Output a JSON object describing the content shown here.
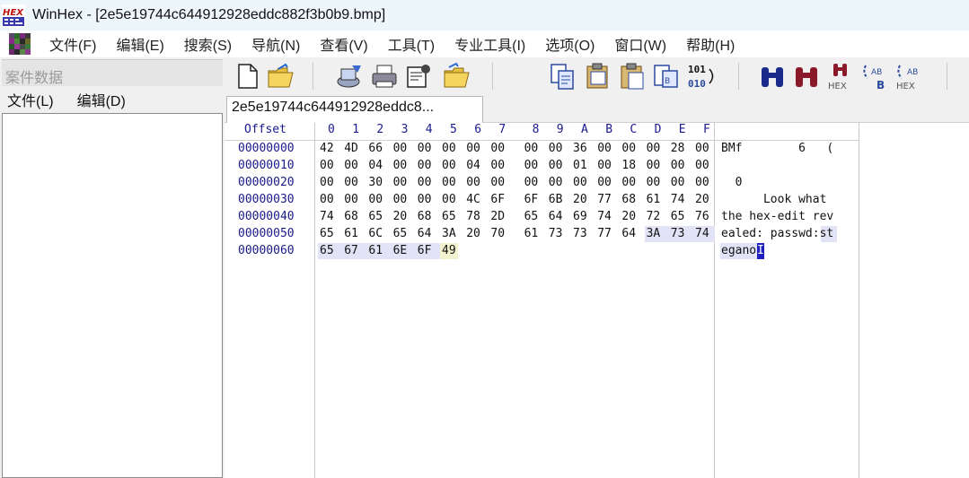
{
  "window": {
    "title": "WinHex - [2e5e19744c644912928eddc882f3b0b9.bmp]",
    "app_icon_text": "HEX"
  },
  "menu": [
    "文件(F)",
    "编辑(E)",
    "搜索(S)",
    "导航(N)",
    "查看(V)",
    "工具(T)",
    "专业工具(I)",
    "选项(O)",
    "窗口(W)",
    "帮助(H)"
  ],
  "left_pane": {
    "header": "案件数据",
    "menu": [
      "文件(L)",
      "编辑(D)"
    ]
  },
  "toolbar_icons": [
    "new-file-icon",
    "open-folder-icon",
    "save-disk-icon",
    "print-icon",
    "properties-icon",
    "open-disk-folder-icon",
    "copy-block-icon",
    "clipboard-hex-icon",
    "paste-icon",
    "write-block-icon",
    "binary-convert-icon",
    "find-text-icon",
    "find-hex-icon",
    "find-hex-values-icon",
    "replace-text-icon",
    "replace-hex-icon"
  ],
  "toolbar_text": {
    "binary": [
      "101",
      "010"
    ],
    "hex_label": "HEX",
    "b_label": "B",
    "ab_label": "AB"
  },
  "tab": {
    "label": "2e5e19744c644912928eddc8..."
  },
  "hex": {
    "offset_header": "Offset",
    "columns": [
      "0",
      "1",
      "2",
      "3",
      "4",
      "5",
      "6",
      "7",
      "8",
      "9",
      "A",
      "B",
      "C",
      "D",
      "E",
      "F"
    ],
    "rows": [
      {
        "offset": "00000000",
        "bytes": [
          "42",
          "4D",
          "66",
          "00",
          "00",
          "00",
          "00",
          "00",
          "00",
          "00",
          "36",
          "00",
          "00",
          "00",
          "28",
          "00"
        ],
        "ascii": "BMf        6   ("
      },
      {
        "offset": "00000010",
        "bytes": [
          "00",
          "00",
          "04",
          "00",
          "00",
          "00",
          "04",
          "00",
          "00",
          "00",
          "01",
          "00",
          "18",
          "00",
          "00",
          "00"
        ],
        "ascii": ""
      },
      {
        "offset": "00000020",
        "bytes": [
          "00",
          "00",
          "30",
          "00",
          "00",
          "00",
          "00",
          "00",
          "00",
          "00",
          "00",
          "00",
          "00",
          "00",
          "00",
          "00"
        ],
        "ascii": "  0"
      },
      {
        "offset": "00000030",
        "bytes": [
          "00",
          "00",
          "00",
          "00",
          "00",
          "00",
          "4C",
          "6F",
          "6F",
          "6B",
          "20",
          "77",
          "68",
          "61",
          "74",
          "20"
        ],
        "ascii": "      Look what "
      },
      {
        "offset": "00000040",
        "bytes": [
          "74",
          "68",
          "65",
          "20",
          "68",
          "65",
          "78",
          "2D",
          "65",
          "64",
          "69",
          "74",
          "20",
          "72",
          "65",
          "76"
        ],
        "ascii": "the hex-edit rev"
      },
      {
        "offset": "00000050",
        "bytes": [
          "65",
          "61",
          "6C",
          "65",
          "64",
          "3A",
          "20",
          "70",
          "61",
          "73",
          "73",
          "77",
          "64",
          "3A",
          "73",
          "74"
        ],
        "ascii": "ealed: passwd:st"
      },
      {
        "offset": "00000060",
        "bytes": [
          "65",
          "67",
          "61",
          "6E",
          "6F",
          "49"
        ],
        "ascii": "egano"
      }
    ],
    "cursor_ascii_char": "I"
  },
  "colors": {
    "titlebar": "#edf6fb",
    "offset_text": "#1a1a8c",
    "selection": "#e3e3f7",
    "cursor": "#2020c0"
  }
}
